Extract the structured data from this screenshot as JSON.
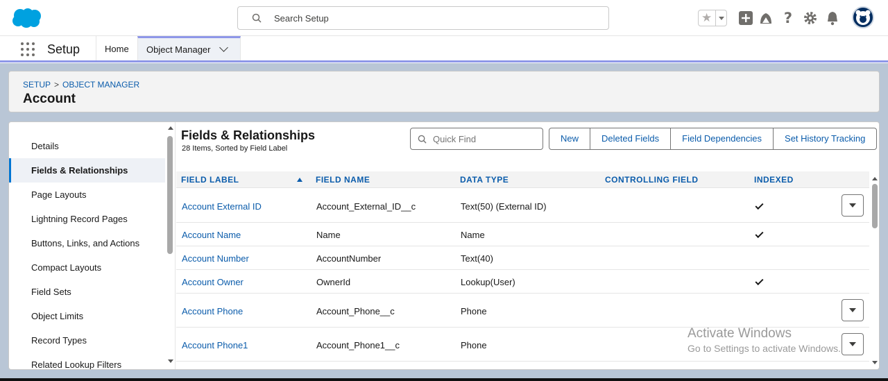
{
  "header": {
    "search_placeholder": "Search Setup",
    "icons": [
      "favorites-star-icon",
      "favorites-dropdown-icon",
      "global-add-icon",
      "trailhead-icon",
      "help-icon",
      "setup-gear-icon",
      "notifications-bell-icon",
      "user-avatar"
    ]
  },
  "nav": {
    "app_name": "Setup",
    "tabs": [
      {
        "label": "Home"
      },
      {
        "label": "Object Manager"
      }
    ]
  },
  "page_header": {
    "breadcrumb": [
      "SETUP",
      "OBJECT MANAGER"
    ],
    "breadcrumb_separator": ">",
    "title": "Account"
  },
  "sidebar": {
    "items": [
      {
        "label": "Details"
      },
      {
        "label": "Fields & Relationships"
      },
      {
        "label": "Page Layouts"
      },
      {
        "label": "Lightning Record Pages"
      },
      {
        "label": "Buttons, Links, and Actions"
      },
      {
        "label": "Compact Layouts"
      },
      {
        "label": "Field Sets"
      },
      {
        "label": "Object Limits"
      },
      {
        "label": "Record Types"
      },
      {
        "label": "Related Lookup Filters"
      }
    ],
    "active_index": 1
  },
  "content": {
    "title": "Fields & Relationships",
    "subtitle": "28 Items, Sorted by Field Label",
    "quick_find_placeholder": "Quick Find",
    "buttons": [
      "New",
      "Deleted Fields",
      "Field Dependencies",
      "Set History Tracking"
    ],
    "columns": [
      "FIELD LABEL",
      "FIELD NAME",
      "DATA TYPE",
      "CONTROLLING FIELD",
      "INDEXED"
    ],
    "rows": [
      {
        "label": "Account External ID",
        "name": "Account_External_ID__c",
        "type": "Text(50) (External ID)",
        "controlling": "",
        "indexed": true,
        "menu": true
      },
      {
        "label": "Account Name",
        "name": "Name",
        "type": "Name",
        "controlling": "",
        "indexed": true,
        "menu": false
      },
      {
        "label": "Account Number",
        "name": "AccountNumber",
        "type": "Text(40)",
        "controlling": "",
        "indexed": false,
        "menu": false
      },
      {
        "label": "Account Owner",
        "name": "OwnerId",
        "type": "Lookup(User)",
        "controlling": "",
        "indexed": true,
        "menu": false
      },
      {
        "label": "Account Phone",
        "name": "Account_Phone__c",
        "type": "Phone",
        "controlling": "",
        "indexed": false,
        "menu": true
      },
      {
        "label": "Account Phone1",
        "name": "Account_Phone1__c",
        "type": "Phone",
        "controlling": "",
        "indexed": false,
        "menu": true
      }
    ]
  },
  "watermark": {
    "line1": "Activate Windows",
    "line2": "Go to Settings to activate Windows."
  },
  "colors": {
    "link": "#0b5cab",
    "brand_cloud": "#00a1e0",
    "nav_accent": "#8e97e8",
    "background": "#b9c6d6"
  }
}
